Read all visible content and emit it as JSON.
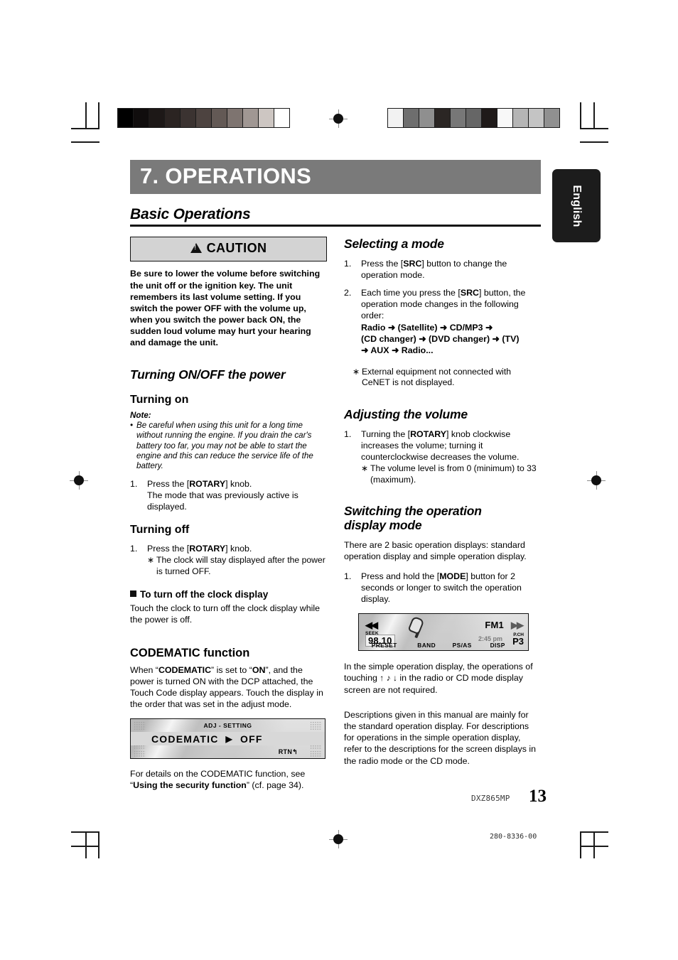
{
  "chapter": {
    "number": "7.",
    "title": "OPERATIONS"
  },
  "section": {
    "title": "Basic Operations"
  },
  "language_tab": {
    "label": "English"
  },
  "caution": {
    "heading": "CAUTION",
    "body": "Be sure to lower the volume before switching the unit off or the ignition key. The unit remembers its last volume setting. If you switch the power OFF with the volume up, when you switch the power back ON, the sudden loud volume may hurt your hearing and damage the unit."
  },
  "left_column": {
    "turning_power": {
      "heading": "Turning ON/OFF the power",
      "turning_on": {
        "heading": "Turning on",
        "note_label": "Note:",
        "note_bullet": "•",
        "note_text": "Be careful when using this unit for a long time without running the engine. If you drain the car's battery too far, you may not be able to start the engine and this can reduce the service life of the battery.",
        "steps": [
          {
            "num": "1.",
            "line1_pre": "Press the [",
            "line1_key": "ROTARY",
            "line1_post": "] knob.",
            "line2": "The mode that was previously active is displayed."
          }
        ]
      },
      "turning_off": {
        "heading": "Turning off",
        "steps": [
          {
            "num": "1.",
            "line1_pre": "Press the [",
            "line1_key": "ROTARY",
            "line1_post": "] knob."
          }
        ],
        "aster_mark": "∗",
        "aster_text": "The clock will stay displayed after the power is turned OFF."
      },
      "clock_off": {
        "heading": "To turn off the clock display",
        "body": "Touch the clock to turn off the clock display while the power is off."
      }
    },
    "codematic": {
      "heading": "CODEMATIC function",
      "body_parts": {
        "p1": "When “",
        "b1": "CODEMATIC",
        "p2": "” is set to “",
        "b2": "ON",
        "p3": "”, and the power is turned ON with the DCP attached, the Touch Code display appears. Touch the display in the order that was set in the adjust mode."
      },
      "lcd": {
        "header": "ADJ - SETTING",
        "item": "CODEMATIC",
        "arrow": "▶",
        "value": "OFF",
        "return": "RTN↰"
      },
      "footer_parts": {
        "p1": "For details on the CODEMATIC function, see “",
        "b1": "Using the security function",
        "p2": "” (cf. page 34)."
      }
    }
  },
  "right_column": {
    "selecting_mode": {
      "heading": "Selecting a mode",
      "steps": [
        {
          "num": "1.",
          "pre": "Press the [",
          "key": "SRC",
          "post": "] button to change the operation mode."
        },
        {
          "num": "2.",
          "pre": "Each time you press the [",
          "key": "SRC",
          "post": "] button, the operation mode changes in the following order:"
        }
      ],
      "mode_flow": [
        "Radio ➜ (Satellite) ➜ CD/MP3 ➜",
        " (CD changer) ➜ (DVD changer) ➜ (TV)",
        "➜ AUX ➜ Radio..."
      ],
      "aster_mark": "∗",
      "aster_text": "External equipment not connected with CeNET is not displayed."
    },
    "adjusting_volume": {
      "heading": "Adjusting the volume",
      "steps": [
        {
          "num": "1.",
          "pre": "Turning the [",
          "key": "ROTARY",
          "post": "] knob clockwise increases the volume; turning it counterclockwise decreases the volume."
        }
      ],
      "aster_mark": "∗",
      "aster_text": "The volume level is from 0 (minimum) to 33 (maximum)."
    },
    "switching_display": {
      "heading_line1": "Switching the operation",
      "heading_line2": "display mode",
      "intro": "There are 2 basic operation displays: standard operation display and simple operation display.",
      "steps": [
        {
          "num": "1.",
          "pre": "Press and hold the [",
          "key": "MODE",
          "post": "] button for 2 seconds or longer to switch the operation display."
        }
      ],
      "lcd": {
        "seek_arrow": "◀◀",
        "ff_arrow": "▶▶",
        "seek_label": "SEEK",
        "frequency": "98.10",
        "band": "FM1",
        "clock": "2:45 pm",
        "pch_label": "P.CH",
        "preset_channel": "P3",
        "soft_keys": [
          "PRESET",
          "BAND",
          "PS/AS",
          "DISP"
        ]
      },
      "para_after_parts": {
        "p1": "In the simple operation display, the operations of touching ",
        "icons": "↑ ♪ ↓",
        "p2": " in the radio or CD mode display screen are not required."
      },
      "para_final": "Descriptions given in this manual are mainly for the standard operation display. For descriptions for operations in the simple operation display, refer to the descriptions for the screen displays in the radio mode or the CD mode."
    }
  },
  "footer": {
    "model": "DXZ865MP",
    "page_number": "13",
    "doc_code": "280-8336-00"
  },
  "print_marks": {
    "swatch_strip_left": [
      "#000000",
      "#100d0d",
      "#1d1817",
      "#2b2422",
      "#3b3331",
      "#4d4340",
      "#635955",
      "#7e7470",
      "#a09793",
      "#cdc6c2",
      "#ffffff"
    ],
    "swatch_strip_right": [
      "#f2f2f2",
      "#6e6e6e",
      "#8f8f8f",
      "#2b2624",
      "#777777",
      "#666666",
      "#1f1a19",
      "#f8f8f8",
      "#b5b5b5",
      "#c4c4c4",
      "#909090"
    ]
  }
}
